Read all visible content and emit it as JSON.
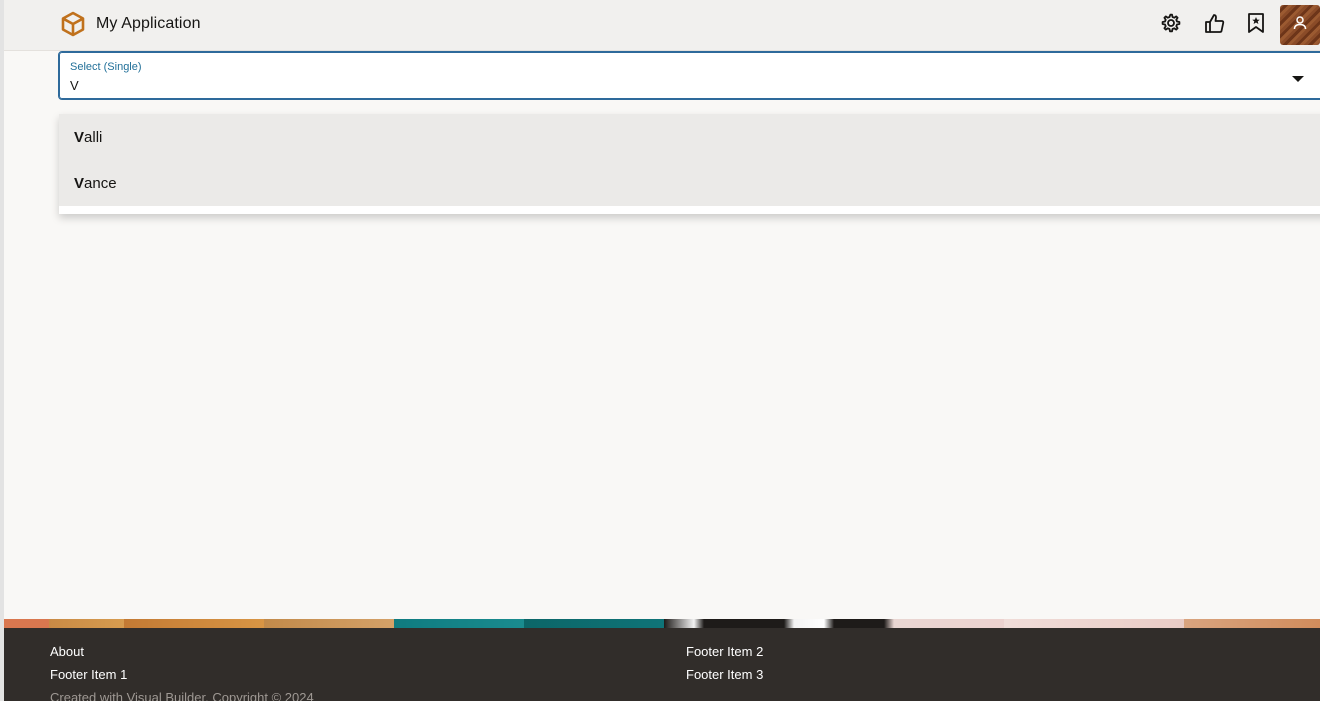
{
  "app": {
    "title": "My Application",
    "brand_color": "#c0711c"
  },
  "header": {
    "actions": [
      {
        "icon": "gear-icon"
      },
      {
        "icon": "thumbs-up-icon"
      },
      {
        "icon": "bookmark-icon"
      },
      {
        "icon": "user-icon"
      }
    ]
  },
  "select": {
    "label": "Select (Single)",
    "value": "V",
    "accent_color": "#2e6a9b"
  },
  "dropdown": {
    "options": [
      {
        "match": "V",
        "rest": "alli"
      },
      {
        "match": "V",
        "rest": "ance"
      }
    ]
  },
  "footer": {
    "col1": [
      "About",
      "Footer Item 1"
    ],
    "col2": [
      "Footer Item 2",
      "Footer Item 3"
    ],
    "copyright": "Created with Visual Builder. Copyright © 2024"
  }
}
